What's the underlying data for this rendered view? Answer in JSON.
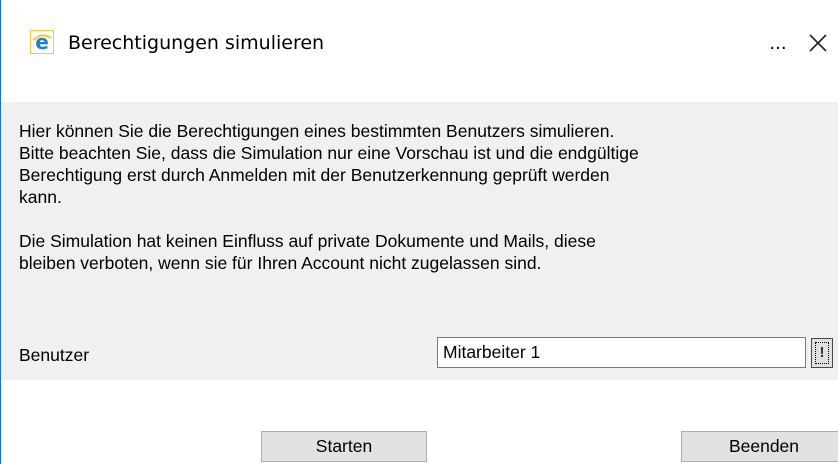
{
  "window": {
    "title": "Berechtigungen simulieren",
    "more_label": "...",
    "app_icon": "internet-explorer-icon",
    "close_icon": "close-icon"
  },
  "description": {
    "paragraph1": "Hier können Sie die Berechtigungen eines bestimmten Benutzers simulieren.\nBitte beachten Sie, dass die Simulation nur eine Vorschau ist und die endgültige\nBerechtigung erst durch Anmelden mit der Benutzerkennung geprüft werden\nkann.",
    "paragraph2": "Die Simulation hat keinen Einfluss auf private Dokumente und Mails, diese\nbleiben verboten, wenn sie für Ihren Account nicht zugelassen sind."
  },
  "user_field": {
    "label": "Benutzer",
    "value": "Mitarbeiter 1",
    "picker_icon": "user-picker-icon"
  },
  "buttons": {
    "start": "Starten",
    "end": "Beenden"
  },
  "colors": {
    "content_bg": "#f0f0f0",
    "button_bg": "#e1e1e1",
    "window_border": "#1e6fcf"
  }
}
